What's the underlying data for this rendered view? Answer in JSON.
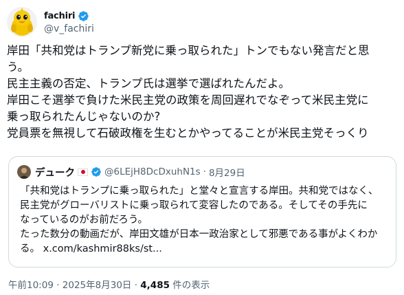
{
  "author": {
    "display_name": "fachiri",
    "handle": "@v_fachiri",
    "avatar_icon": "chick-character-avatar",
    "verified_icon": "verified-badge-icon"
  },
  "tweet": {
    "lines": [
      "岸田「共和党はトランプ新党に乗っ取られた」トンでもない発言だと思",
      "う。",
      "民主主義の否定、トランプ氏は選挙で選ばれたんだよ。",
      "岸田こそ選挙で負けた米民主党の政策を周回遅れでなぞって米民主党に",
      "乗っ取られたんじゃないのか?",
      "党員票を無視して石破政権を生むとかやってることが米民主党そっくり"
    ]
  },
  "quote": {
    "display_name": "デューク",
    "flag_icon": "japan-flag-icon",
    "handle": "@6LEjH8DcDxuhN1s",
    "separator": "·",
    "date": "8月29日",
    "lines": [
      "「共和党はトランプに乗っ取られた」と堂々と宣言する岸田。共和党ではなく、",
      "民主党がグローバリストに乗っ取られて変容したのである。そしてその手先に",
      "なっているのがお前だろう。",
      "たった数分の動画だが、岸田文雄が日本一政治家として邪悪である事がよくわか",
      "る。 x.com/kashmir88ks/st..."
    ]
  },
  "meta": {
    "timestamp": "午前10:09 · 2025年8月30日 · ",
    "views": "4,485",
    "views_suffix": " 件の表示"
  },
  "colors": {
    "text": "#0f1419",
    "secondary": "#536471",
    "border": "#cfd9de",
    "verified_blue": "#1d9bf0"
  }
}
